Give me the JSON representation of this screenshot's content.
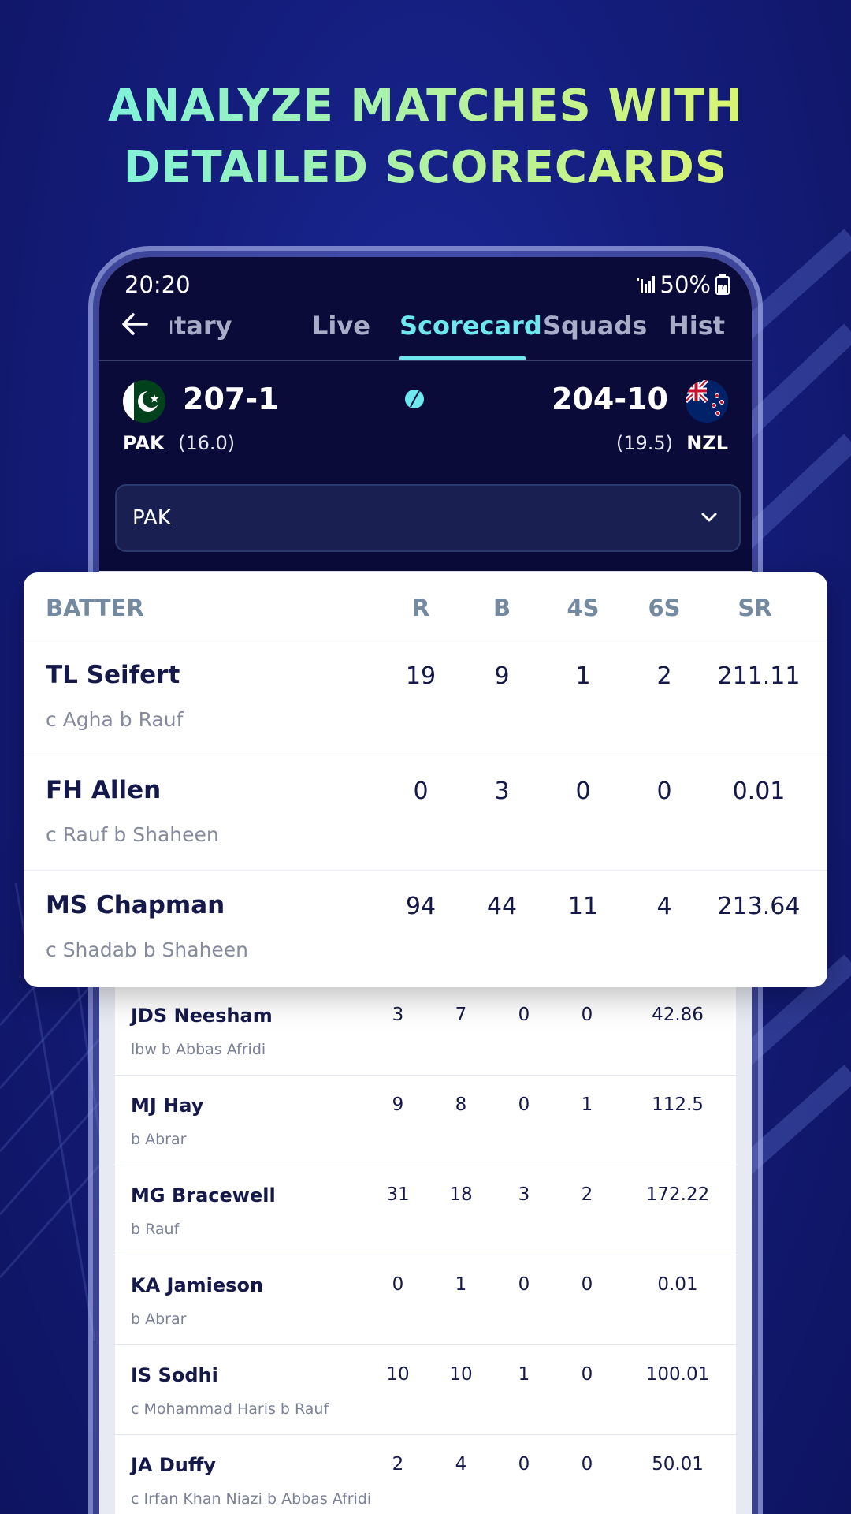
{
  "headline": {
    "line1": "ANALYZE MATCHES WITH",
    "line2": "DETAILED SCORECARDS"
  },
  "status": {
    "time": "20:20",
    "battery": "50%"
  },
  "tabs": [
    {
      "label": "ıtary",
      "active": false
    },
    {
      "label": "Live",
      "active": false
    },
    {
      "label": "Scorecard",
      "active": true
    },
    {
      "label": "Squads",
      "active": false
    },
    {
      "label": "Hist",
      "active": false
    }
  ],
  "match": {
    "team1": {
      "code": "PAK",
      "score": "207-1",
      "overs": "(16.0)"
    },
    "team2": {
      "code": "NZL",
      "score": "204-10",
      "overs": "(19.5)"
    }
  },
  "innings_select": {
    "value": "PAK"
  },
  "batting_headers": {
    "batter": "BATTER",
    "r": "R",
    "b": "B",
    "fours": "4S",
    "sixes": "6S",
    "sr": "SR"
  },
  "featured_batters": [
    {
      "name": "TL Seifert",
      "dismissal": "c Agha b Rauf",
      "r": "19",
      "b": "9",
      "fours": "1",
      "sixes": "2",
      "sr": "211.11"
    },
    {
      "name": "FH Allen",
      "dismissal": "c Rauf b Shaheen",
      "r": "0",
      "b": "3",
      "fours": "0",
      "sixes": "0",
      "sr": "0.01"
    },
    {
      "name": "MS Chapman",
      "dismissal": "c Shadab b Shaheen",
      "r": "94",
      "b": "44",
      "fours": "11",
      "sixes": "4",
      "sr": "213.64"
    }
  ],
  "batters": [
    {
      "name": "JDS Neesham",
      "dismissal": "lbw b Abbas Afridi",
      "r": "3",
      "b": "7",
      "fours": "0",
      "sixes": "0",
      "sr": "42.86"
    },
    {
      "name": "MJ Hay",
      "dismissal": "b Abrar",
      "r": "9",
      "b": "8",
      "fours": "0",
      "sixes": "1",
      "sr": "112.5"
    },
    {
      "name": "MG Bracewell",
      "dismissal": "b Rauf",
      "r": "31",
      "b": "18",
      "fours": "3",
      "sixes": "2",
      "sr": "172.22"
    },
    {
      "name": "KA Jamieson",
      "dismissal": "b Abrar",
      "r": "0",
      "b": "1",
      "fours": "0",
      "sixes": "0",
      "sr": "0.01"
    },
    {
      "name": "IS Sodhi",
      "dismissal": "c Mohammad Haris b Rauf",
      "r": "10",
      "b": "10",
      "fours": "1",
      "sixes": "0",
      "sr": "100.01"
    },
    {
      "name": "JA Duffy",
      "dismissal": "c Irfan Khan Niazi b Abbas Afridi",
      "r": "2",
      "b": "4",
      "fours": "0",
      "sixes": "0",
      "sr": "50.01"
    }
  ],
  "colors": {
    "accent": "#6fe7ee",
    "header_bg": "#0b0b3a",
    "page_bg": "#12196b"
  }
}
